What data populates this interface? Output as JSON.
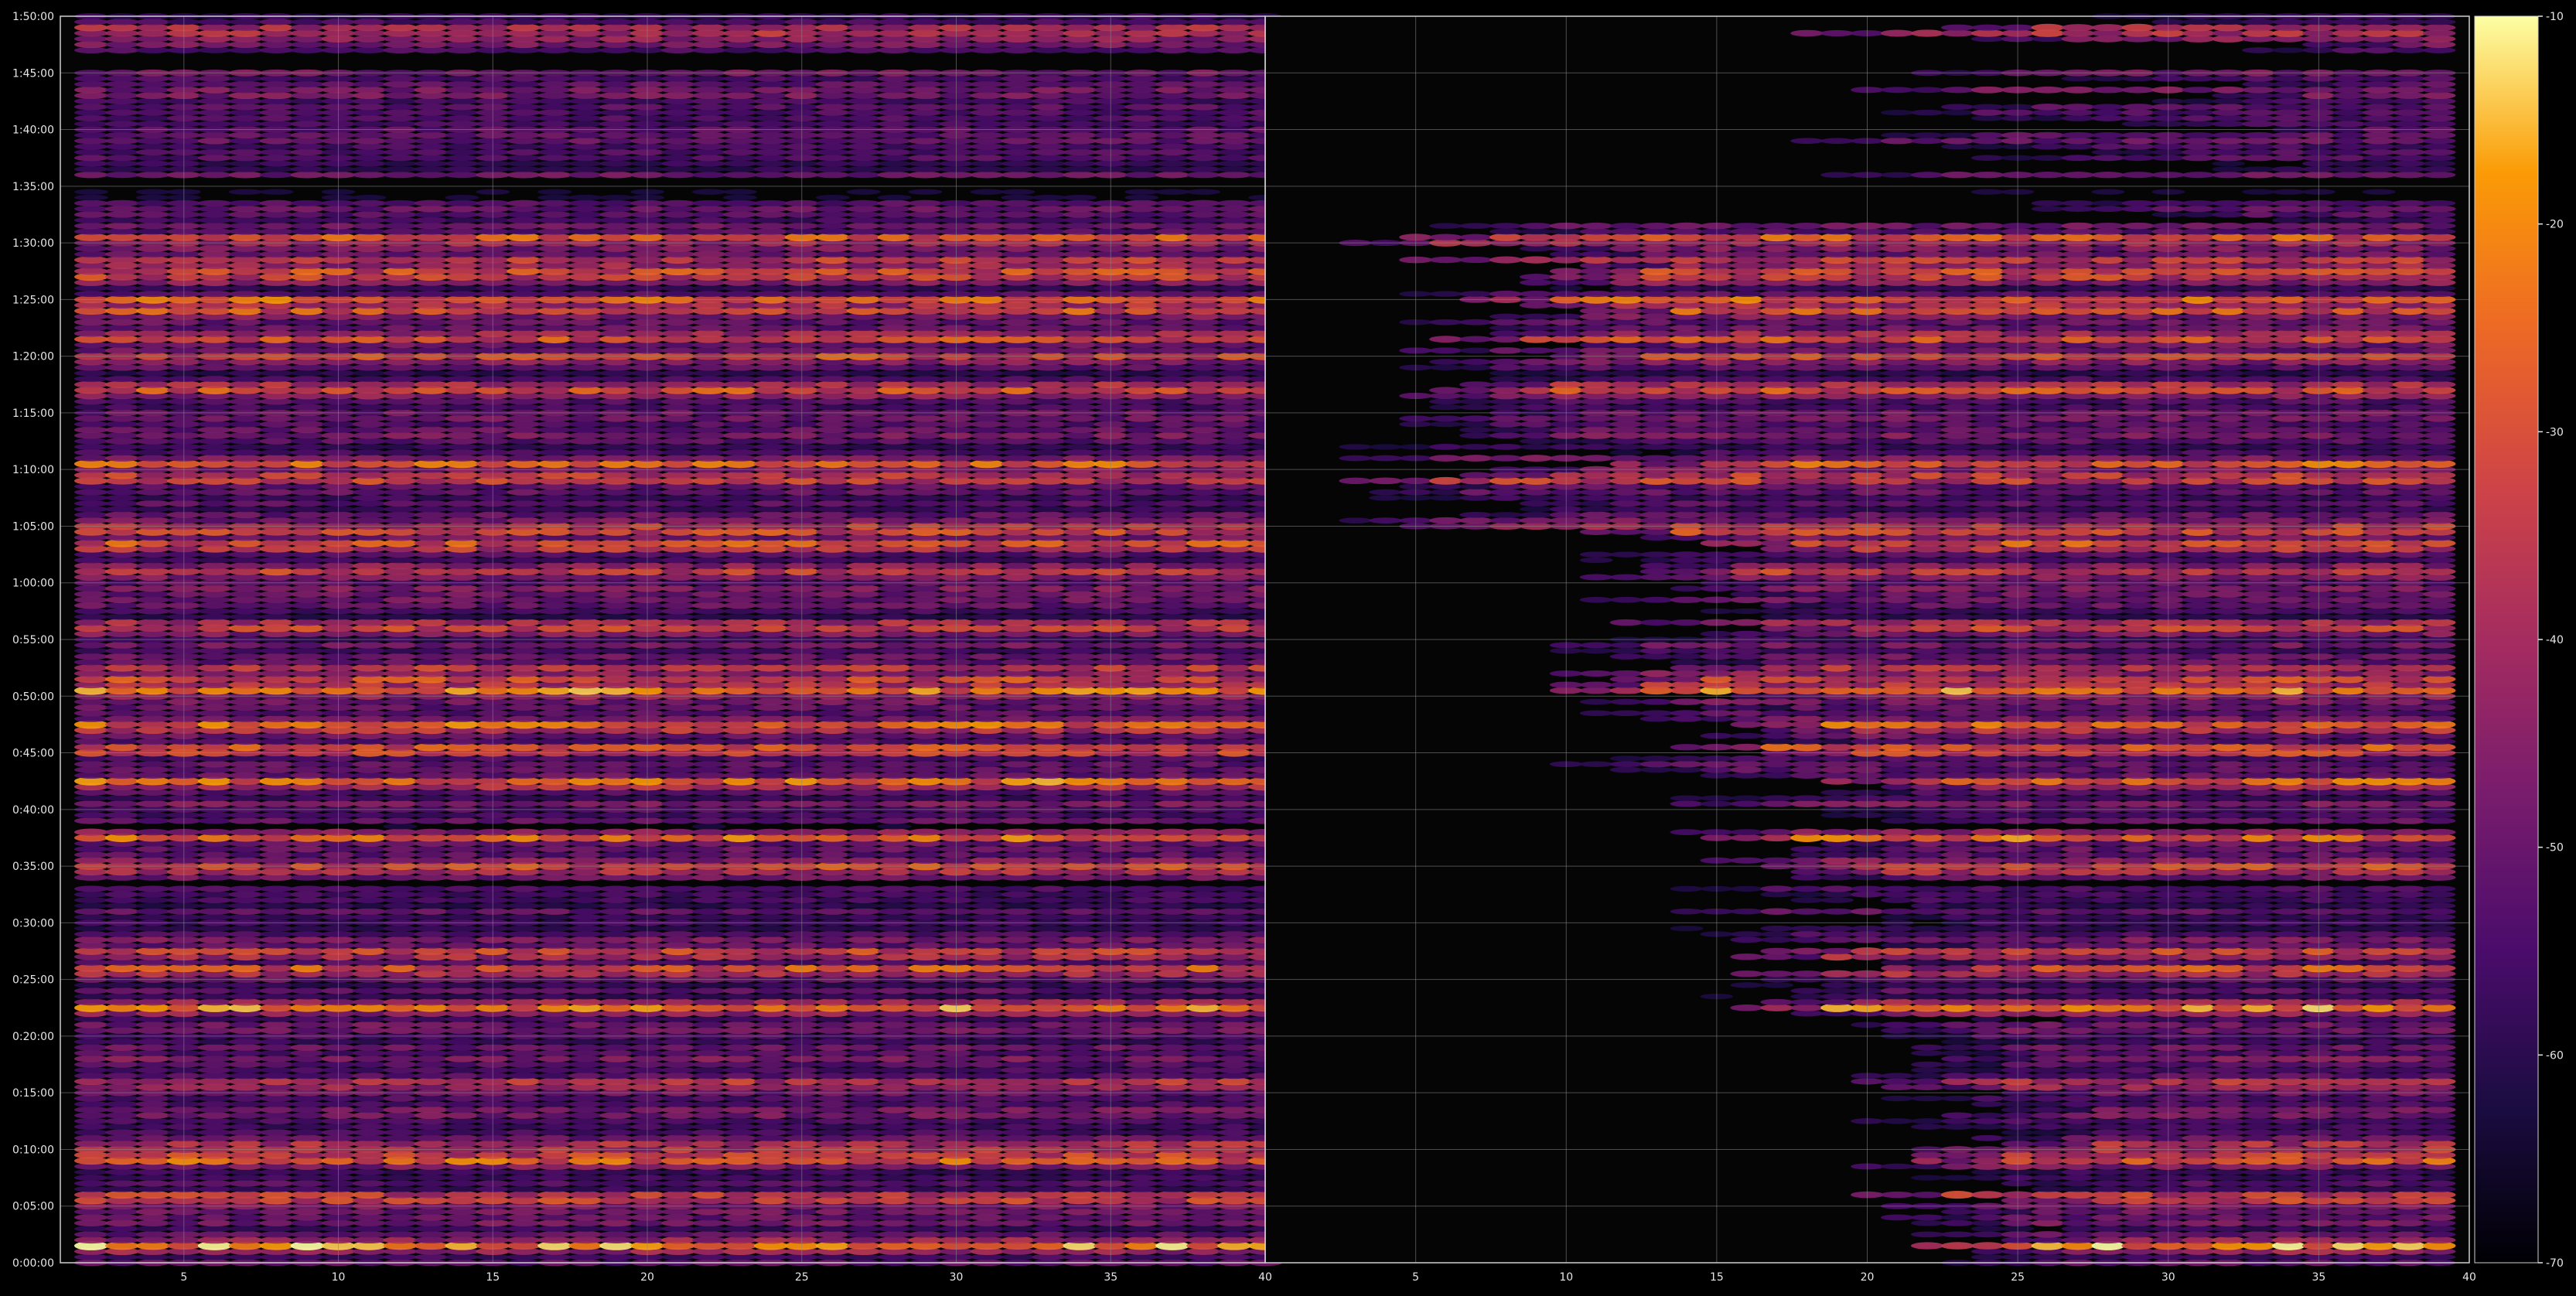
{
  "chart_data": {
    "type": "heatmap",
    "title": "",
    "xlabel": "",
    "ylabel": "",
    "panels": [
      {
        "name": "left",
        "xlim": [
          1,
          40
        ],
        "xticks": [
          5,
          10,
          15,
          20,
          25,
          30,
          35,
          40
        ],
        "channels": [
          2,
          40
        ],
        "reference_gap_channels": [],
        "ylim_seconds": [
          0,
          6600
        ]
      },
      {
        "name": "right",
        "xlim": [
          0,
          40
        ],
        "xticks": [
          5,
          10,
          15,
          20,
          25,
          30,
          35,
          40
        ],
        "channels": [
          1,
          39
        ],
        "onset_map": "later frames appear progressively from channel ~20 downward; most rows begin near channel 15-20",
        "ylim_seconds": [
          0,
          6600
        ]
      }
    ],
    "yticks": [
      "0:00:00",
      "0:05:00",
      "0:10:00",
      "0:15:00",
      "0:20:00",
      "0:25:00",
      "0:30:00",
      "0:35:00",
      "0:40:00",
      "0:45:00",
      "0:50:00",
      "0:55:00",
      "1:00:00",
      "1:05:00",
      "1:10:00",
      "1:15:00",
      "1:20:00",
      "1:25:00",
      "1:30:00",
      "1:35:00",
      "1:40:00",
      "1:45:00",
      "1:50:00"
    ],
    "colorbar": {
      "colormap": "inferno",
      "range": [
        -70,
        -10
      ],
      "ticks": [
        "-10",
        "-20",
        "-30",
        "-40",
        "-50",
        "-60",
        "-70"
      ]
    },
    "bright_rows_seconds": [
      90,
      340,
      550,
      610,
      950,
      1350,
      1550,
      1640,
      2090,
      2250,
      2550,
      2720,
      2850,
      3030,
      3070,
      3140,
      3370,
      3670,
      3800,
      3880,
      4150,
      4230,
      4620,
      4800,
      4890,
      5040,
      5090,
      5230,
      5300,
      5420,
      6520
    ],
    "grid": true,
    "background_color": "#000000",
    "grid_color": "#8a8a8a"
  }
}
